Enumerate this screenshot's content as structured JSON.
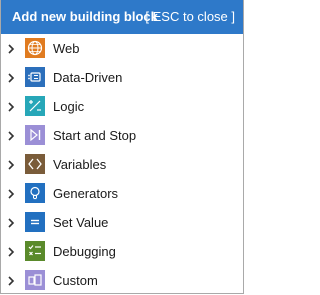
{
  "header": {
    "title": "Add new building block",
    "esc_label": "[ ESC to close ]"
  },
  "items": [
    {
      "label": "Web",
      "icon": "globe-icon",
      "color": "#e07b20"
    },
    {
      "label": "Data-Driven",
      "icon": "data-driven-icon",
      "color": "#2c6fbb"
    },
    {
      "label": "Logic",
      "icon": "logic-icon",
      "color": "#27a7b8"
    },
    {
      "label": "Start and Stop",
      "icon": "start-stop-icon",
      "color": "#9b8fd6"
    },
    {
      "label": "Variables",
      "icon": "variables-icon",
      "color": "#7a5c3a"
    },
    {
      "label": "Generators",
      "icon": "lightbulb-icon",
      "color": "#2270c0"
    },
    {
      "label": "Set Value",
      "icon": "set-value-icon",
      "color": "#2270c0"
    },
    {
      "label": "Debugging",
      "icon": "debugging-icon",
      "color": "#5a8a2b"
    },
    {
      "label": "Custom",
      "icon": "custom-icon",
      "color": "#9b8fd6"
    }
  ]
}
